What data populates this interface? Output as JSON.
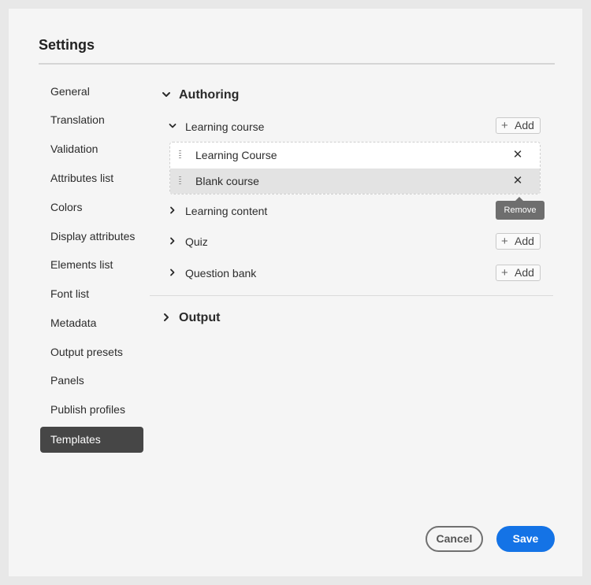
{
  "dialog": {
    "title": "Settings"
  },
  "sidebar": {
    "items": [
      {
        "label": "General"
      },
      {
        "label": "Translation"
      },
      {
        "label": "Validation"
      },
      {
        "label": "Attributes list"
      },
      {
        "label": "Colors"
      },
      {
        "label": "Display attributes"
      },
      {
        "label": "Elements list"
      },
      {
        "label": "Font list"
      },
      {
        "label": "Metadata"
      },
      {
        "label": "Output presets"
      },
      {
        "label": "Panels"
      },
      {
        "label": "Publish profiles"
      },
      {
        "label": "Templates"
      }
    ],
    "selected": "Templates"
  },
  "content": {
    "authoring": {
      "title": "Authoring",
      "expanded": true,
      "subsections": [
        {
          "label": "Learning course",
          "expanded": true,
          "add_label": "Add",
          "items": [
            {
              "label": "Learning Course"
            },
            {
              "label": "Blank course"
            }
          ]
        },
        {
          "label": "Learning content",
          "expanded": false
        },
        {
          "label": "Quiz",
          "expanded": false,
          "add_label": "Add"
        },
        {
          "label": "Question bank",
          "expanded": false,
          "add_label": "Add"
        }
      ],
      "tooltip": "Remove"
    },
    "output": {
      "title": "Output",
      "expanded": false
    }
  },
  "footer": {
    "cancel_label": "Cancel",
    "save_label": "Save"
  },
  "colors": {
    "accent": "#1473e6",
    "selected_nav_bg": "#464646",
    "tooltip_bg": "#6e6e6e"
  }
}
